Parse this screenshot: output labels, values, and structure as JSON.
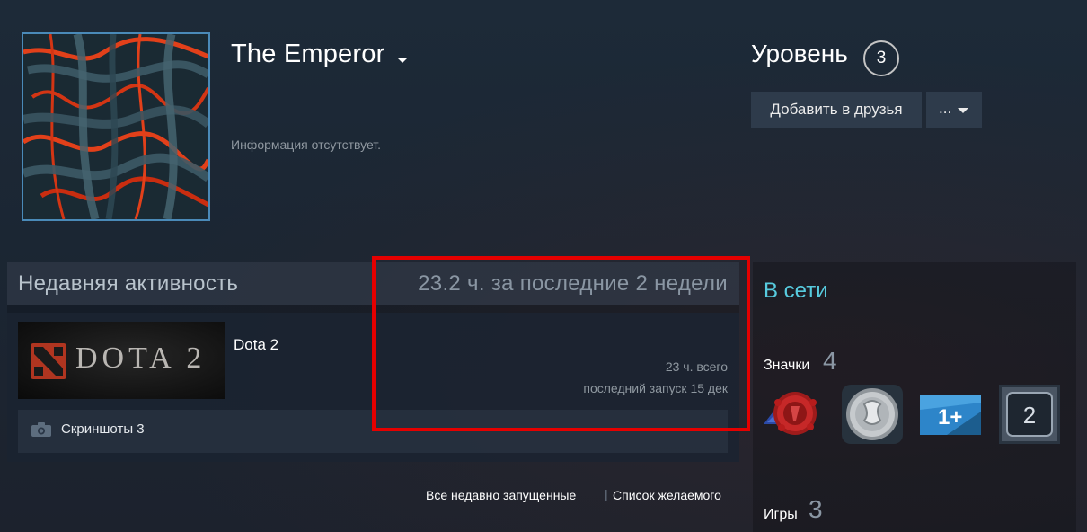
{
  "profile": {
    "persona_name": "The Emperor",
    "summary": "Информация отсутствует.",
    "level_label": "Уровень",
    "level_value": "3",
    "add_friend_label": "Добавить в друзья",
    "more_label": "..."
  },
  "activity": {
    "title": "Недавняя активность",
    "hours_summary": "23.2 ч. за последние 2 недели",
    "game": {
      "capsule_text": "DOTA 2",
      "name": "Dota 2",
      "total": "23 ч. всего",
      "last_played": "последний запуск 15 дек"
    },
    "screenshots_label": "Скриншоты 3",
    "link_all_recent": "Все недавно запущенные",
    "link_separator": "|",
    "link_wishlist": "Список желаемого"
  },
  "sidebar": {
    "status": "В сети",
    "badges_label": "Значки",
    "badges_count": "4",
    "badge_icons": [
      "steam-years-badge-icon",
      "coin-badge-icon",
      "one-plus-badge-icon",
      "level-two-badge-icon"
    ],
    "badge4_number": "2",
    "badge3_text": "1+",
    "games_label": "Игры",
    "games_count": "3"
  },
  "colors": {
    "online": "#57cbde",
    "highlight": "#e50000",
    "button_bg": "#2e3b4b"
  }
}
